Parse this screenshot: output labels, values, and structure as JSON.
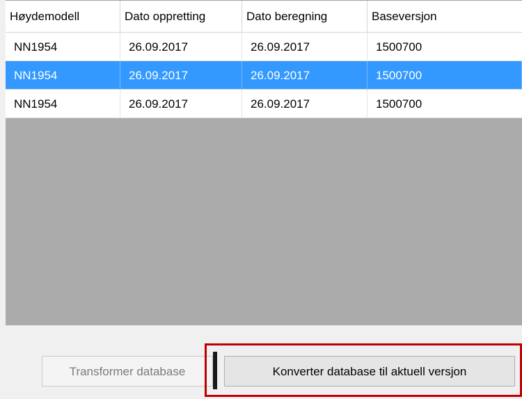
{
  "table": {
    "columns": [
      "Høydemodell",
      "Dato oppretting",
      "Dato beregning",
      "Baseversjon"
    ],
    "rows": [
      {
        "hoydemodell": "NN1954",
        "dato_oppretting": "26.09.2017",
        "dato_beregning": "26.09.2017",
        "baseversjon": "1500700",
        "selected": false
      },
      {
        "hoydemodell": "NN1954",
        "dato_oppretting": "26.09.2017",
        "dato_beregning": "26.09.2017",
        "baseversjon": "1500700",
        "selected": true
      },
      {
        "hoydemodell": "NN1954",
        "dato_oppretting": "26.09.2017",
        "dato_beregning": "26.09.2017",
        "baseversjon": "1500700",
        "selected": false
      }
    ]
  },
  "buttons": {
    "transform_label": "Transformer database",
    "transform_enabled": false,
    "convert_label": "Konverter database til aktuell versjon"
  },
  "colors": {
    "selection": "#3399ff",
    "empty_grid": "#ababab",
    "highlight": "#c00000"
  }
}
